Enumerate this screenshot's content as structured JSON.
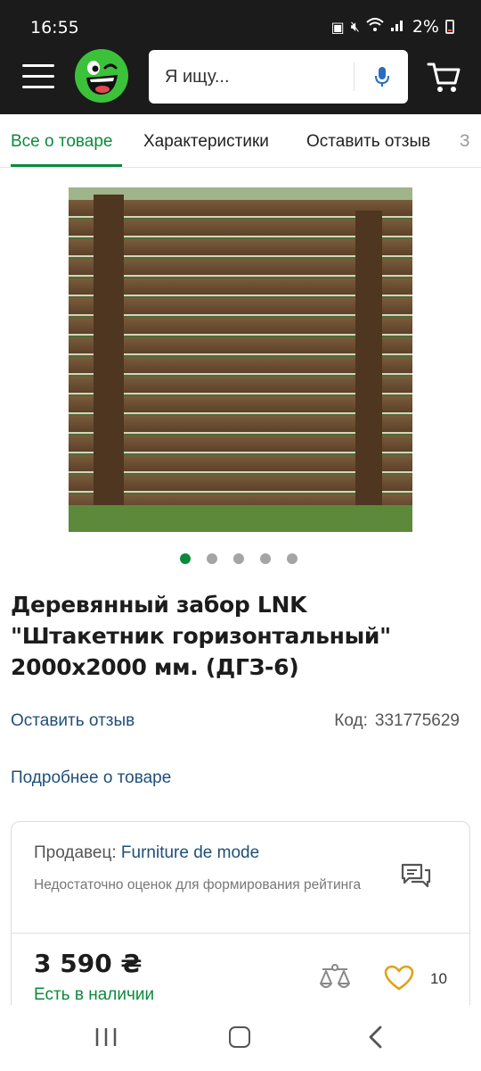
{
  "status_bar": {
    "time": "16:55",
    "battery": "2%"
  },
  "header": {
    "search_placeholder": "Я ищу...",
    "icons": [
      "menu-icon",
      "logo",
      "mic-icon",
      "cart-icon"
    ]
  },
  "tabs": [
    {
      "label": "Все о товаре",
      "active": true
    },
    {
      "label": "Характеристики",
      "active": false
    },
    {
      "label": "Оставить отзыв",
      "active": false
    },
    {
      "label": "З",
      "active": false
    }
  ],
  "gallery": {
    "image_alt": "Деревянный горизонтальный забор",
    "count": 5,
    "active_index": 0
  },
  "product": {
    "title": "Деревянный забор LNK \"Штакетник горизонтальный\" 2000х2000 мм. (ДГЗ-6)",
    "review_link": "Оставить отзыв",
    "code_label": "Код:",
    "code_value": "331775629",
    "more_link": "Подробнее о товаре"
  },
  "seller": {
    "label": "Продавец:",
    "name": "Furniture de mode",
    "rating_note": "Недостаточно оценок для формирования рейтинга",
    "price": "3 590 ₴",
    "availability": "Есть в наличии",
    "favorites_count": "10"
  },
  "colors": {
    "accent": "#0b8a3b",
    "link": "#1f4f78",
    "heart": "#e0a11a",
    "header_bg": "#1b1b1b"
  }
}
